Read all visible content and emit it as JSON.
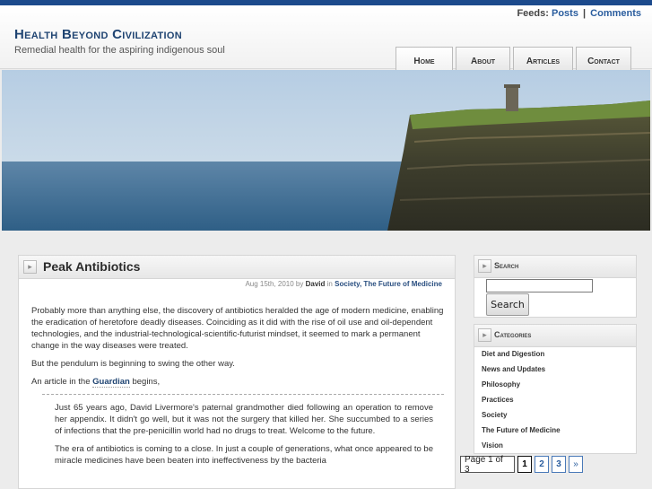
{
  "header": {
    "feeds_label": "Feeds:",
    "posts_link": "Posts",
    "separator": "|",
    "comments_link": "Comments",
    "site_title": "Health Beyond Civilization",
    "tagline": "Remedial health for the aspiring indigenous soul"
  },
  "nav": {
    "home": "Home",
    "about": "About",
    "articles": "Articles",
    "contact": "Contact"
  },
  "post": {
    "title": "Peak Antibiotics",
    "date": "Aug 15th, 2010 by",
    "author": "David",
    "in_label": "in",
    "categories": "Society, The Future of Medicine",
    "p1": "Probably more than anything else, the discovery of antibiotics heralded the age of modern medicine, enabling the eradication of heretofore deadly diseases. Coinciding as it did with the rise of oil use and oil-dependent technologies, and the industrial-technological-scientific-futurist mindset, it seemed to mark a permanent change in the way diseases were treated.",
    "p2": "But the pendulum is beginning to swing the other way.",
    "p3_pre": "An article in the",
    "p3_link": "Guardian",
    "p3_post": "begins,",
    "quote1": "Just 65 years ago, David Livermore's paternal grandmother died following an operation to remove her appendix. It didn't go well, but it was not the surgery that killed her. She succumbed to a series of infections that the pre-penicillin world had no drugs to treat. Welcome to the future.",
    "quote2": "The era of antibiotics is coming to a close. In just a couple of generations, what once appeared to be miracle medicines have been beaten into ineffectiveness by the bacteria"
  },
  "sidebar": {
    "search_title": "Search",
    "search_button": "Search",
    "search_value": "",
    "categories_title": "Categories",
    "categories": [
      "Diet and Digestion",
      "News and Updates",
      "Philosophy",
      "Practices",
      "Society",
      "The Future of Medicine",
      "Vision"
    ]
  },
  "pager": {
    "info": "Page 1 of 3",
    "current": "1",
    "page2": "2",
    "page3": "3",
    "next": "»"
  },
  "icons": {
    "arrow": "arrow-right-icon"
  },
  "colors": {
    "topbar": "#1c4a8c",
    "title": "#1f4472",
    "link": "#2a5d9e"
  }
}
